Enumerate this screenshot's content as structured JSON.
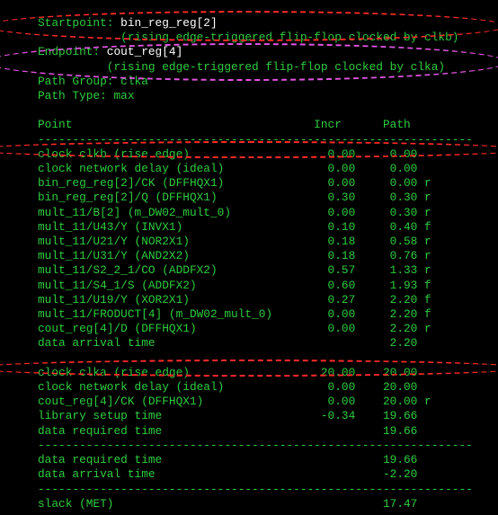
{
  "header": {
    "startpoint_label": "Startpoint: ",
    "startpoint_name": "bin_reg_reg[2]",
    "startpoint_desc": "            (rising edge-triggered flip-flop clocked by clkb)",
    "endpoint_label": "Endpoint: ",
    "endpoint_name": "cout_reg[4]",
    "endpoint_desc": "          (rising edge-triggered flip-flop clocked by clka)",
    "path_group": "Path Group: clka",
    "path_type": "Path Type: max"
  },
  "cols": {
    "point": "Point",
    "incr": "Incr",
    "path": "Path"
  },
  "dash": "---------------------------------------------------------------",
  "rows": [
    {
      "name": "clock clkb (rise edge)",
      "incr": "0.00",
      "path": "0.00",
      "flag": ""
    },
    {
      "name": "clock network delay (ideal)",
      "incr": "0.00",
      "path": "0.00",
      "flag": ""
    },
    {
      "name": "bin_reg_reg[2]/CK (DFFHQX1)",
      "incr": "0.00",
      "path": "0.00",
      "flag": "r"
    },
    {
      "name": "bin_reg_reg[2]/Q (DFFHQX1)",
      "incr": "0.30",
      "path": "0.30",
      "flag": "r"
    },
    {
      "name": "mult_11/B[2] (m_DW02_mult_0)",
      "incr": "0.00",
      "path": "0.30",
      "flag": "r"
    },
    {
      "name": "mult_11/U43/Y (INVX1)",
      "incr": "0.10",
      "path": "0.40",
      "flag": "f"
    },
    {
      "name": "mult_11/U21/Y (NOR2X1)",
      "incr": "0.18",
      "path": "0.58",
      "flag": "r"
    },
    {
      "name": "mult_11/U31/Y (AND2X2)",
      "incr": "0.18",
      "path": "0.76",
      "flag": "r"
    },
    {
      "name": "mult_11/S2_2_1/CO (ADDFX2)",
      "incr": "0.57",
      "path": "1.33",
      "flag": "r"
    },
    {
      "name": "mult_11/S4_1/S (ADDFX2)",
      "incr": "0.60",
      "path": "1.93",
      "flag": "f"
    },
    {
      "name": "mult_11/U19/Y (XOR2X1)",
      "incr": "0.27",
      "path": "2.20",
      "flag": "f"
    },
    {
      "name": "mult_11/FRODUCT[4] (m_DW02_mult_0)",
      "incr": "0.00",
      "path": "2.20",
      "flag": "f"
    },
    {
      "name": "cout_reg[4]/D (DFFHQX1)",
      "incr": "0.00",
      "path": "2.20",
      "flag": "r"
    },
    {
      "name": "data arrival time",
      "incr": "",
      "path": "2.20",
      "flag": ""
    }
  ],
  "rows2": [
    {
      "name": "clock clka (rise edge)",
      "incr": "20.00",
      "path": "20.00",
      "flag": ""
    },
    {
      "name": "clock network delay (ideal)",
      "incr": "0.00",
      "path": "20.00",
      "flag": ""
    },
    {
      "name": "cout_reg[4]/CK (DFFHQX1)",
      "incr": "0.00",
      "path": "20.00",
      "flag": "r"
    },
    {
      "name": "library setup time",
      "incr": "-0.34",
      "path": "19.66",
      "flag": ""
    },
    {
      "name": "data required time",
      "incr": "",
      "path": "19.66",
      "flag": ""
    }
  ],
  "summary": {
    "req": {
      "name": "data required time",
      "path": "19.66"
    },
    "arr": {
      "name": "data arrival time",
      "path": "-2.20"
    },
    "slack": {
      "name": "slack (MET)",
      "path": "17.47"
    }
  }
}
